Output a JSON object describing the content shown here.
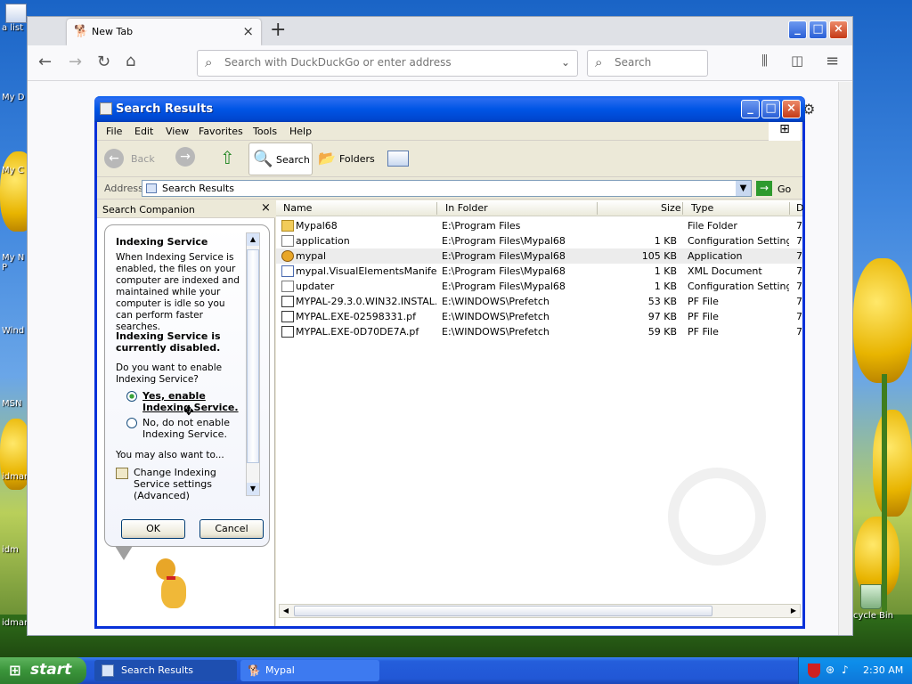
{
  "desktop": {
    "icons": [
      "a list",
      "My D",
      "My C",
      "My N P",
      "Wind",
      "MSN",
      "idman",
      "idm",
      "idman"
    ],
    "recycle_label": "cycle Bin"
  },
  "firefox": {
    "tab_title": "New Tab",
    "url_placeholder": "Search with DuckDuckGo or enter address",
    "search_placeholder": "Search"
  },
  "search_results": {
    "title": "Search Results",
    "menu": [
      "File",
      "Edit",
      "View",
      "Favorites",
      "Tools",
      "Help"
    ],
    "toolbar": {
      "back": "Back",
      "search": "Search",
      "folders": "Folders"
    },
    "address_label": "Address",
    "address_value": "Search Results",
    "go": "Go",
    "companion": {
      "header": "Search Companion",
      "heading": "Indexing Service",
      "para1": "When Indexing Service is enabled, the files on your computer are indexed and maintained while your computer is idle so you can perform faster searches.",
      "status": "Indexing Service is currently disabled.",
      "question": "Do you want to enable Indexing Service?",
      "option_yes": "Yes, enable Indexing Service.",
      "option_no": "No, do not enable Indexing Service.",
      "also": "You may also want to...",
      "link": "Change Indexing Service settings (Advanced)",
      "ok": "OK",
      "cancel": "Cancel"
    },
    "columns": {
      "name": "Name",
      "folder": "In Folder",
      "size": "Size",
      "type": "Type",
      "extra": "D"
    },
    "rows": [
      {
        "name": "Mypal68",
        "folder": "E:\\Program Files",
        "size": "",
        "type": "File Folder",
        "icon": "folder"
      },
      {
        "name": "application",
        "folder": "E:\\Program Files\\Mypal68",
        "size": "1 KB",
        "type": "Configuration Settings",
        "icon": "config"
      },
      {
        "name": "mypal",
        "folder": "E:\\Program Files\\Mypal68",
        "size": "105 KB",
        "type": "Application",
        "icon": "app"
      },
      {
        "name": "mypal.VisualElementsManifest",
        "folder": "E:\\Program Files\\Mypal68",
        "size": "1 KB",
        "type": "XML Document",
        "icon": "xml"
      },
      {
        "name": "updater",
        "folder": "E:\\Program Files\\Mypal68",
        "size": "1 KB",
        "type": "Configuration Settings",
        "icon": "config"
      },
      {
        "name": "MYPAL-29.3.0.WIN32.INSTAL...",
        "folder": "E:\\WINDOWS\\Prefetch",
        "size": "53 KB",
        "type": "PF File",
        "icon": "pf"
      },
      {
        "name": "MYPAL.EXE-02598331.pf",
        "folder": "E:\\WINDOWS\\Prefetch",
        "size": "97 KB",
        "type": "PF File",
        "icon": "pf"
      },
      {
        "name": "MYPAL.EXE-0D70DE7A.pf",
        "folder": "E:\\WINDOWS\\Prefetch",
        "size": "59 KB",
        "type": "PF File",
        "icon": "pf"
      }
    ],
    "row_extra": "7"
  },
  "taskbar": {
    "start": "start",
    "items": [
      "Search Results",
      "Mypal"
    ],
    "clock": "2:30 AM"
  },
  "colors": {
    "xp_blue": "#0055e5",
    "start_green": "#3a943a",
    "selection": "#ececec"
  }
}
